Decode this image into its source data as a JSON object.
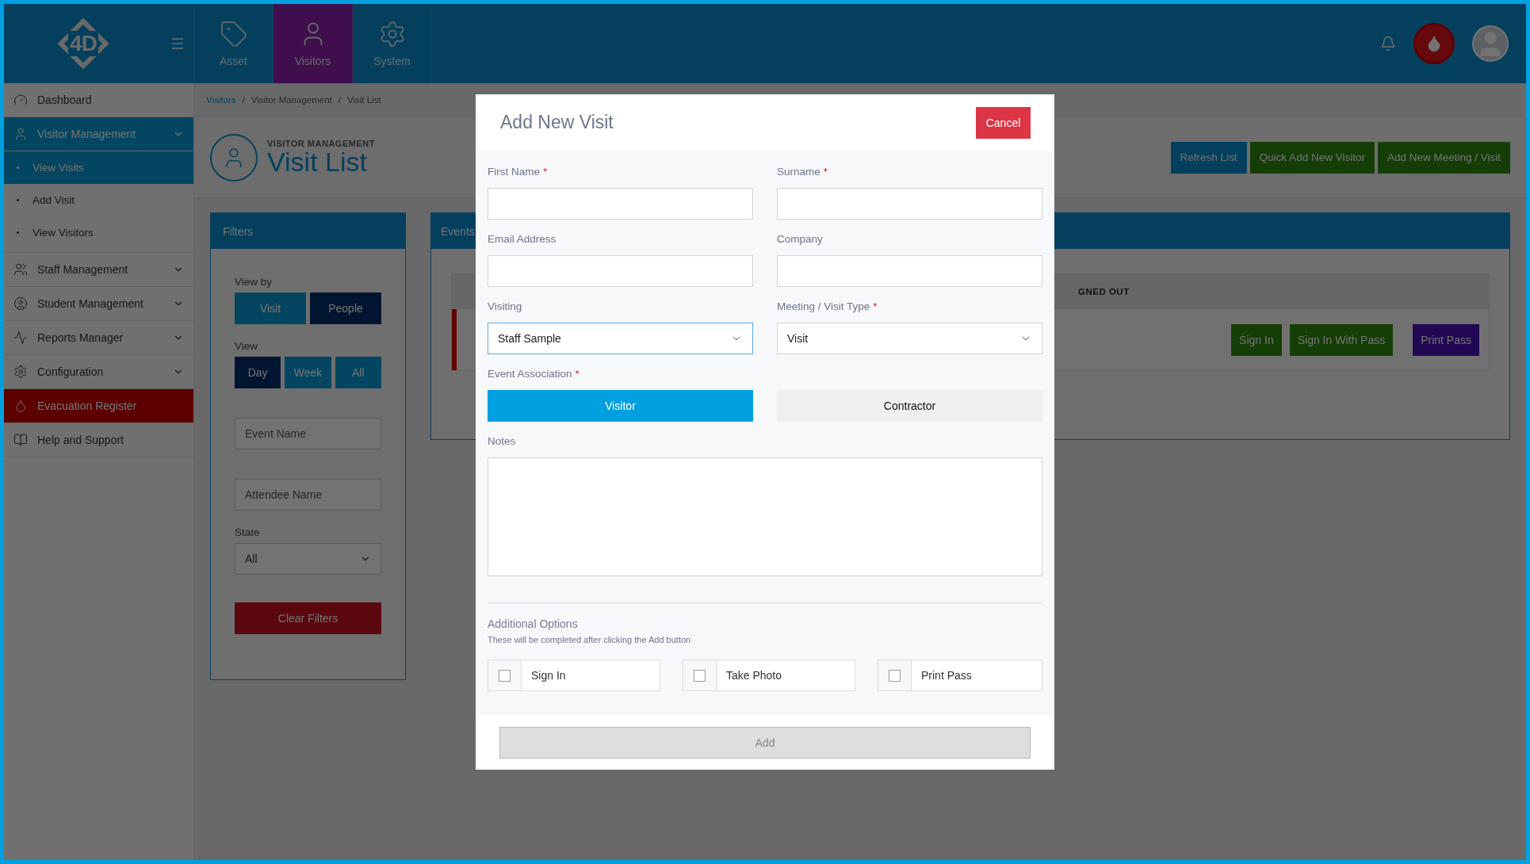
{
  "top_bar": {
    "logo_text": "4D",
    "tabs": [
      {
        "label": "Asset",
        "selected": false
      },
      {
        "label": "Visitors",
        "selected": true
      },
      {
        "label": "System",
        "selected": false
      }
    ]
  },
  "sidebar": {
    "items": [
      {
        "label": "Dashboard",
        "kind": "link"
      },
      {
        "label": "Visitor Management",
        "kind": "group",
        "expanded": true,
        "children": [
          {
            "label": "View Visits",
            "selected": true
          },
          {
            "label": "Add Visit",
            "selected": false
          },
          {
            "label": "View Visitors",
            "selected": false
          }
        ]
      },
      {
        "label": "Staff Management",
        "kind": "group",
        "expanded": false
      },
      {
        "label": "Student Management",
        "kind": "group",
        "expanded": false
      },
      {
        "label": "Reports Manager",
        "kind": "group",
        "expanded": false
      },
      {
        "label": "Configuration",
        "kind": "group",
        "expanded": false
      },
      {
        "label": "Evacuation Register",
        "kind": "alert"
      },
      {
        "label": "Help and Support",
        "kind": "link"
      }
    ]
  },
  "breadcrumb": {
    "separator": "/",
    "items": [
      "Visitors",
      "Visitor Management",
      "Visit List"
    ]
  },
  "page_header": {
    "eyebrow": "VISITOR MANAGEMENT",
    "title": "Visit List",
    "actions": [
      {
        "label": "Refresh List",
        "kind": "primary"
      },
      {
        "label": "Quick Add New Visitor",
        "kind": "success"
      },
      {
        "label": "Add New Meeting / Visit",
        "kind": "success"
      }
    ]
  },
  "filters": {
    "title": "Filters",
    "view_by": {
      "label": "View by",
      "options": [
        {
          "label": "Visit",
          "selected": false
        },
        {
          "label": "People",
          "selected": true
        }
      ]
    },
    "view": {
      "label": "View",
      "options": [
        {
          "label": "Day",
          "selected": true
        },
        {
          "label": "Week",
          "selected": false
        },
        {
          "label": "All",
          "selected": false
        }
      ]
    },
    "inputs": [
      {
        "placeholder": "Event Name"
      },
      {
        "placeholder": "Attendee Name"
      }
    ],
    "state": {
      "label": "State",
      "value": "All"
    },
    "clear_button": "Clear Filters"
  },
  "events": {
    "title": "Events",
    "column_header": "GNED OUT",
    "rows": [
      {
        "actions": [
          {
            "label": "Sign In",
            "kind": "success"
          },
          {
            "label": "Sign In With Pass",
            "kind": "success"
          },
          {
            "label": "Print Pass",
            "kind": "print"
          }
        ]
      }
    ]
  },
  "modal": {
    "title": "Add New Visit",
    "cancel": "Cancel",
    "fields": [
      {
        "label": "First Name",
        "required_mark": "*",
        "kind": "text"
      },
      {
        "label": "Surname",
        "required_mark": "*",
        "kind": "text"
      },
      {
        "label": "Email Address",
        "kind": "text"
      },
      {
        "label": "Company",
        "kind": "text"
      },
      {
        "label": "Visiting",
        "kind": "select",
        "value": "Staff Sample",
        "focused": true
      },
      {
        "label": "Meeting / Visit Type",
        "required_mark": "*",
        "kind": "select",
        "value": "Visit",
        "focused": false
      }
    ],
    "association": {
      "label": "Event Association",
      "required_mark": "*",
      "options": [
        {
          "label": "Visitor",
          "selected": true
        },
        {
          "label": "Contractor",
          "selected": false
        }
      ]
    },
    "notes": {
      "label": "Notes"
    },
    "additional": {
      "title": "Additional Options",
      "hint": "These will be completed after clicking the Add button",
      "options": [
        {
          "label": "Sign In",
          "checked": false
        },
        {
          "label": "Take Photo",
          "checked": false
        },
        {
          "label": "Print Pass",
          "checked": false
        }
      ]
    },
    "submit": {
      "label": "Add",
      "disabled": true
    }
  }
}
